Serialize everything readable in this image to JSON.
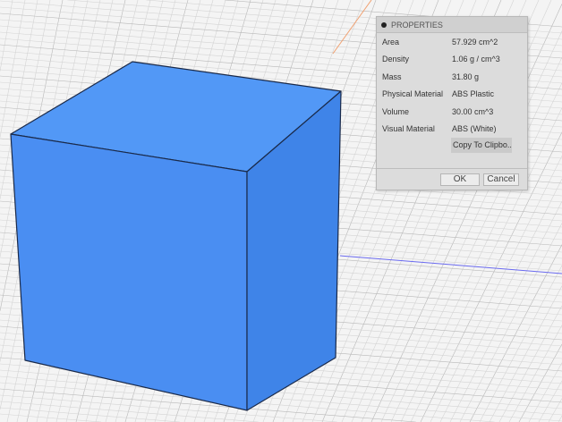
{
  "properties_panel": {
    "title": "PROPERTIES",
    "rows": [
      {
        "label": "Area",
        "value": "57.929 cm^2"
      },
      {
        "label": "Density",
        "value": "1.06 g / cm^3"
      },
      {
        "label": "Mass",
        "value": "31.80 g"
      },
      {
        "label": "Physical Material",
        "value": "ABS Plastic"
      },
      {
        "label": "Volume",
        "value": "30.00 cm^3"
      },
      {
        "label": "Visual Material",
        "value": "ABS (White)"
      }
    ],
    "copy_label": "Copy To Clipbo...",
    "ok_label": "OK",
    "cancel_label": "Cancel"
  },
  "colors": {
    "cube_top": "#5298f6",
    "cube_front": "#4a8ef2",
    "cube_right": "#3f84e8",
    "axis_blue": "#6a6af0",
    "axis_orange": "#f0a070"
  }
}
